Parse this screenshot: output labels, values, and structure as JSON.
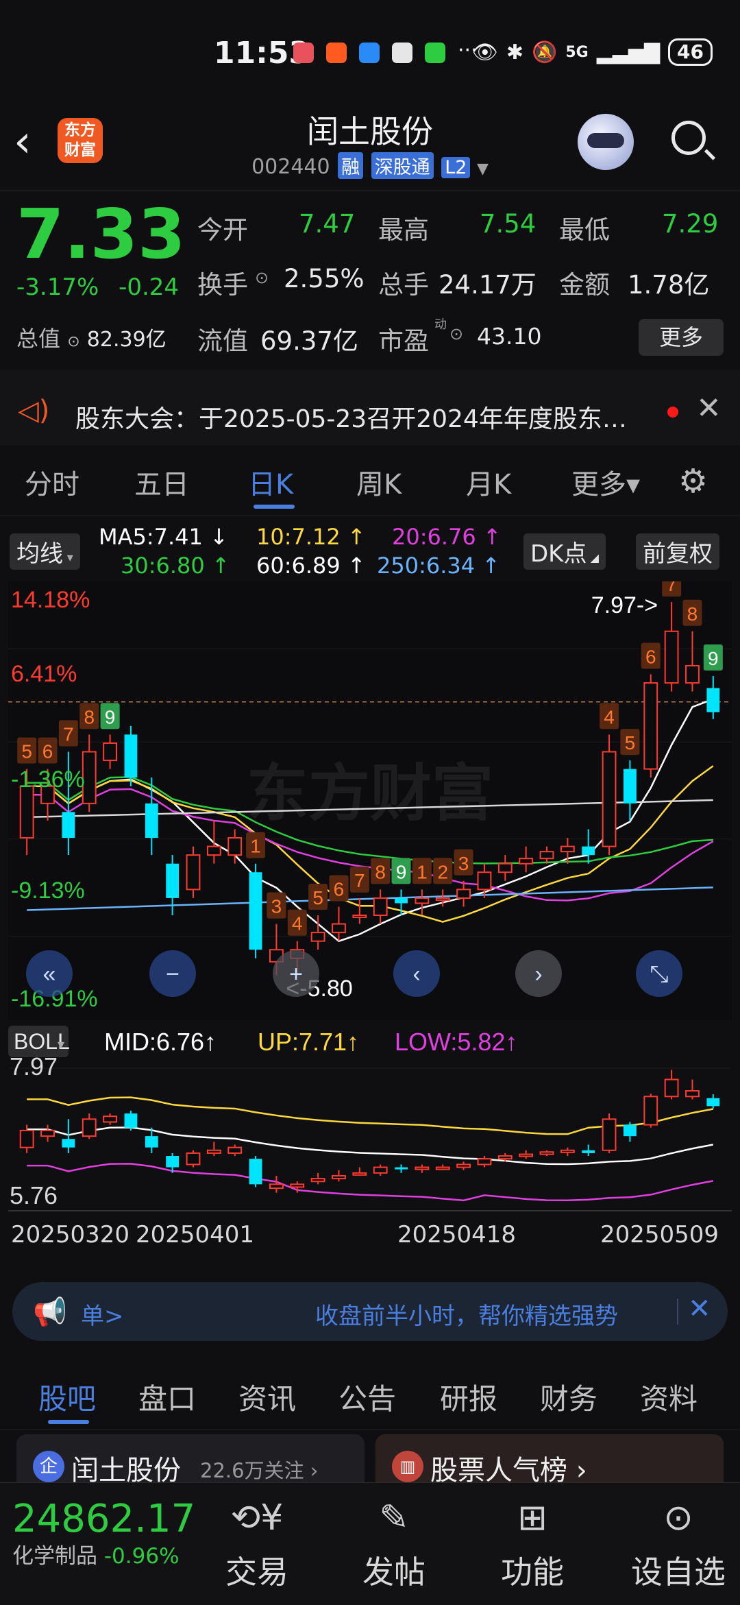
{
  "status_bar": {
    "time": "11:53",
    "battery": "46",
    "network": "5G",
    "overflow": "···"
  },
  "header": {
    "back": "‹",
    "logo_line1": "东方",
    "logo_line2": "财富",
    "title": "闰土股份",
    "code": "002440",
    "tags": [
      "融",
      "深股通",
      "L2"
    ]
  },
  "quote": {
    "price": "7.33",
    "change_pct": "-3.17%",
    "change": "-0.24",
    "total_cap_label": "总值",
    "total_cap": "82.39亿",
    "fields": [
      {
        "label": "今开",
        "value": "7.47"
      },
      {
        "label": "最高",
        "value": "7.54"
      },
      {
        "label": "最低",
        "value": "7.29"
      },
      {
        "label": "换手",
        "value": "2.55%"
      },
      {
        "label": "总手",
        "value": "24.17万"
      },
      {
        "label": "金额",
        "value": "1.78亿"
      },
      {
        "label": "流值",
        "value": "69.37亿"
      },
      {
        "label": "市盈",
        "value": "43.10"
      }
    ],
    "pe_sup": "动",
    "more_label": "更多"
  },
  "notice": {
    "text": "股东大会：于2025-05-23召开2024年年度股东…"
  },
  "period_tabs": [
    "分时",
    "五日",
    "日K",
    "周K",
    "月K",
    "更多▾"
  ],
  "ma_legend": {
    "ma_button": "均线",
    "items": [
      {
        "text": "MA5:7.41 ↓",
        "color": "#ffffff"
      },
      {
        "text": "10:7.12 ↑",
        "color": "#ffd93d"
      },
      {
        "text": "20:6.76 ↑",
        "color": "#e040e0"
      },
      {
        "text": "30:6.80 ↑",
        "color": "#2ecc40"
      },
      {
        "text": "60:6.89 ↑",
        "color": "#ffffff"
      },
      {
        "text": "250:6.34 ↑",
        "color": "#6ab4ff"
      }
    ],
    "dk_button": "DK点",
    "adjust_button": "前复权"
  },
  "chart_data": {
    "type": "candlestick",
    "watermark": "东方财富",
    "pct_labels": [
      "14.18%",
      "6.41%",
      "-1.36%",
      "-9.13%",
      "-16.91%"
    ],
    "high_marker": "7.97->",
    "low_marker": "<-5.80",
    "candles": [
      {
        "o": 6.6,
        "c": 6.9,
        "h": 7.0,
        "l": 6.5
      },
      {
        "o": 6.8,
        "c": 6.9,
        "h": 7.0,
        "l": 6.7
      },
      {
        "o": 6.75,
        "c": 6.6,
        "h": 7.1,
        "l": 6.5
      },
      {
        "o": 6.8,
        "c": 7.1,
        "h": 7.2,
        "l": 6.75
      },
      {
        "o": 7.05,
        "c": 7.15,
        "h": 7.2,
        "l": 7.0
      },
      {
        "o": 7.2,
        "c": 6.95,
        "h": 7.25,
        "l": 6.9
      },
      {
        "o": 6.8,
        "c": 6.6,
        "h": 6.95,
        "l": 6.5
      },
      {
        "o": 6.45,
        "c": 6.25,
        "h": 6.5,
        "l": 6.15
      },
      {
        "o": 6.3,
        "c": 6.5,
        "h": 6.55,
        "l": 6.25
      },
      {
        "o": 6.5,
        "c": 6.55,
        "h": 6.7,
        "l": 6.45
      },
      {
        "o": 6.5,
        "c": 6.6,
        "h": 6.65,
        "l": 6.45
      },
      {
        "o": 6.4,
        "c": 5.95,
        "h": 6.45,
        "l": 5.9
      },
      {
        "o": 5.88,
        "c": 5.95,
        "h": 6.1,
        "l": 5.8
      },
      {
        "o": 5.9,
        "c": 5.95,
        "h": 6.0,
        "l": 5.8
      },
      {
        "o": 6.0,
        "c": 6.05,
        "h": 6.15,
        "l": 5.95
      },
      {
        "o": 6.05,
        "c": 6.1,
        "h": 6.2,
        "l": 6.0
      },
      {
        "o": 6.15,
        "c": 6.15,
        "h": 6.25,
        "l": 6.1
      },
      {
        "o": 6.15,
        "c": 6.25,
        "h": 6.3,
        "l": 6.1
      },
      {
        "o": 6.25,
        "c": 6.22,
        "h": 6.3,
        "l": 6.15
      },
      {
        "o": 6.22,
        "c": 6.25,
        "h": 6.3,
        "l": 6.15
      },
      {
        "o": 6.25,
        "c": 6.25,
        "h": 6.3,
        "l": 6.2
      },
      {
        "o": 6.25,
        "c": 6.3,
        "h": 6.35,
        "l": 6.2
      },
      {
        "o": 6.3,
        "c": 6.4,
        "h": 6.45,
        "l": 6.25
      },
      {
        "o": 6.4,
        "c": 6.45,
        "h": 6.5,
        "l": 6.35
      },
      {
        "o": 6.45,
        "c": 6.48,
        "h": 6.55,
        "l": 6.4
      },
      {
        "o": 6.48,
        "c": 6.52,
        "h": 6.55,
        "l": 6.45
      },
      {
        "o": 6.52,
        "c": 6.55,
        "h": 6.6,
        "l": 6.45
      },
      {
        "o": 6.55,
        "c": 6.5,
        "h": 6.65,
        "l": 6.45
      },
      {
        "o": 6.55,
        "c": 7.1,
        "h": 7.2,
        "l": 6.5
      },
      {
        "o": 7.0,
        "c": 6.8,
        "h": 7.05,
        "l": 6.7
      },
      {
        "o": 7.0,
        "c": 7.5,
        "h": 7.55,
        "l": 6.95
      },
      {
        "o": 7.5,
        "c": 7.8,
        "h": 7.97,
        "l": 7.45
      },
      {
        "o": 7.5,
        "c": 7.6,
        "h": 7.8,
        "l": 7.45
      },
      {
        "o": 7.47,
        "c": 7.33,
        "h": 7.54,
        "l": 7.29
      }
    ],
    "nine_turn": [
      {
        "i": 0,
        "n": "5",
        "kind": "up"
      },
      {
        "i": 1,
        "n": "6",
        "kind": "up"
      },
      {
        "i": 2,
        "n": "7",
        "kind": "up"
      },
      {
        "i": 3,
        "n": "8",
        "kind": "up"
      },
      {
        "i": 4,
        "n": "9",
        "kind": "green"
      },
      {
        "i": 11,
        "n": "1",
        "kind": "up"
      },
      {
        "i": 12,
        "n": "2",
        "kind": "up"
      },
      {
        "i": 12,
        "n": "3",
        "kind": "up"
      },
      {
        "i": 13,
        "n": "4",
        "kind": "up"
      },
      {
        "i": 14,
        "n": "5",
        "kind": "up"
      },
      {
        "i": 15,
        "n": "6",
        "kind": "up"
      },
      {
        "i": 16,
        "n": "7",
        "kind": "up"
      },
      {
        "i": 17,
        "n": "8",
        "kind": "up"
      },
      {
        "i": 18,
        "n": "9",
        "kind": "green"
      },
      {
        "i": 19,
        "n": "1",
        "kind": "up"
      },
      {
        "i": 20,
        "n": "2",
        "kind": "up"
      },
      {
        "i": 21,
        "n": "3",
        "kind": "up"
      },
      {
        "i": 28,
        "n": "4",
        "kind": "up"
      },
      {
        "i": 29,
        "n": "5",
        "kind": "up"
      },
      {
        "i": 30,
        "n": "6",
        "kind": "up"
      },
      {
        "i": 31,
        "n": "7",
        "kind": "up"
      },
      {
        "i": 32,
        "n": "8",
        "kind": "up"
      },
      {
        "i": 33,
        "n": "9",
        "kind": "green"
      }
    ],
    "boll": {
      "label": "BOLL",
      "mid": "MID:6.76↑",
      "up": "UP:7.71↑",
      "low": "LOW:5.82↑",
      "max": "7.97",
      "min": "5.76"
    },
    "x_dates": [
      "20250320",
      "20250401",
      "20250418",
      "20250509"
    ]
  },
  "banner": {
    "left_text": "单>",
    "text": "收盘前半小时，帮你精选强势",
    "close": "✕"
  },
  "content_tabs": [
    "股吧",
    "盘口",
    "资讯",
    "公告",
    "研报",
    "财务",
    "资料"
  ],
  "cards": {
    "left_badge": "企",
    "left_title": "闰土股份",
    "left_sub": "22.6万关注 ›",
    "right_title": "股票人气榜 ›"
  },
  "bottom_bar": {
    "index_value": "24862.17",
    "index_name": "化学制品",
    "index_change": "-0.96%",
    "items": [
      {
        "label": "交易",
        "icon": "yen-icon"
      },
      {
        "label": "发帖",
        "icon": "edit-icon"
      },
      {
        "label": "功能",
        "icon": "grid-icon"
      },
      {
        "label": "设自选",
        "icon": "dots-icon"
      }
    ]
  }
}
